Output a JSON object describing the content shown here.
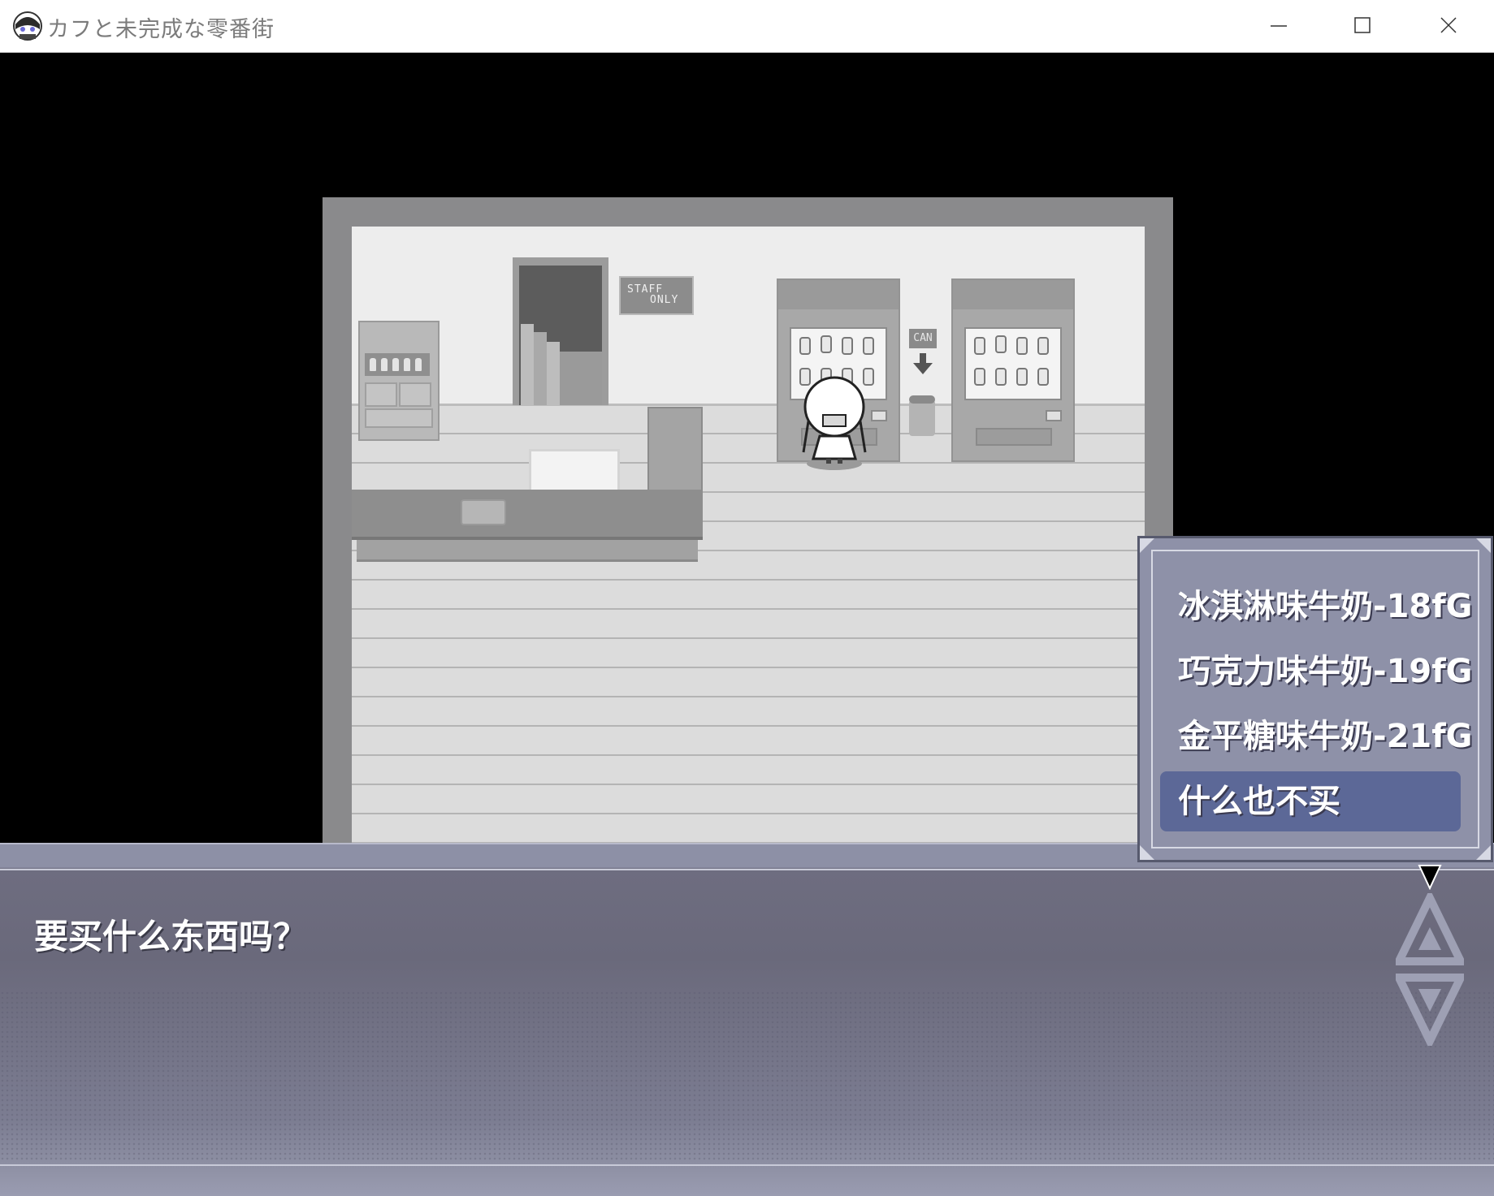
{
  "window": {
    "title": "カフと未完成な零番街"
  },
  "scene": {
    "sign_staff_line1": "STAFF",
    "sign_staff_line2": "ONLY",
    "can_sign": "CAN"
  },
  "message": {
    "text": "要买什么东西吗？"
  },
  "choices": [
    {
      "label": "冰淇淋味牛奶-18fG",
      "selected": false
    },
    {
      "label": "巧克力味牛奶-19fG",
      "selected": false
    },
    {
      "label": "金平糖味牛奶-21fG",
      "selected": false
    },
    {
      "label": "什么也不买",
      "selected": true
    }
  ],
  "colors": {
    "message_box": "#6e6d80",
    "choice_window": "#8e91a8",
    "choice_selected": "#5c6897"
  }
}
